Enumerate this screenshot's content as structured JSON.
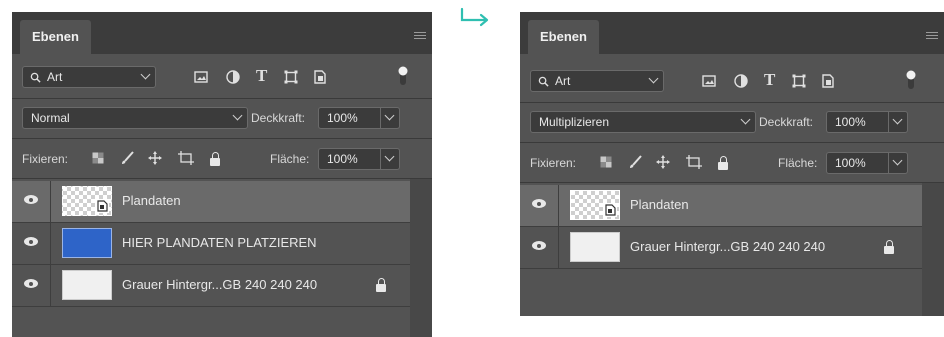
{
  "accent_color": "#2fbfb1",
  "panels": [
    {
      "tab_label": "Ebenen",
      "filter_label": "Art",
      "blend_mode": "Normal",
      "opacity_label": "Deckkraft:",
      "opacity_value": "100%",
      "lock_label": "Fixieren:",
      "fill_label": "Fläche:",
      "fill_value": "100%",
      "layers": [
        {
          "name": "Plandaten",
          "thumb": "checker-smartobject",
          "selected": true,
          "locked": false
        },
        {
          "name": "HIER PLANDATEN PLATZIEREN",
          "thumb": "blue",
          "selected": false,
          "locked": false
        },
        {
          "name": "Grauer Hintergr...GB 240 240 240",
          "thumb": "light",
          "selected": false,
          "locked": true
        }
      ]
    },
    {
      "tab_label": "Ebenen",
      "filter_label": "Art",
      "blend_mode": "Multiplizieren",
      "opacity_label": "Deckkraft:",
      "opacity_value": "100%",
      "lock_label": "Fixieren:",
      "fill_label": "Fläche:",
      "fill_value": "100%",
      "layers": [
        {
          "name": "Plandaten",
          "thumb": "checker-smartobject",
          "selected": true,
          "locked": false
        },
        {
          "name": "Grauer Hintergr...GB 240 240 240",
          "thumb": "light",
          "selected": false,
          "locked": true
        }
      ]
    }
  ]
}
